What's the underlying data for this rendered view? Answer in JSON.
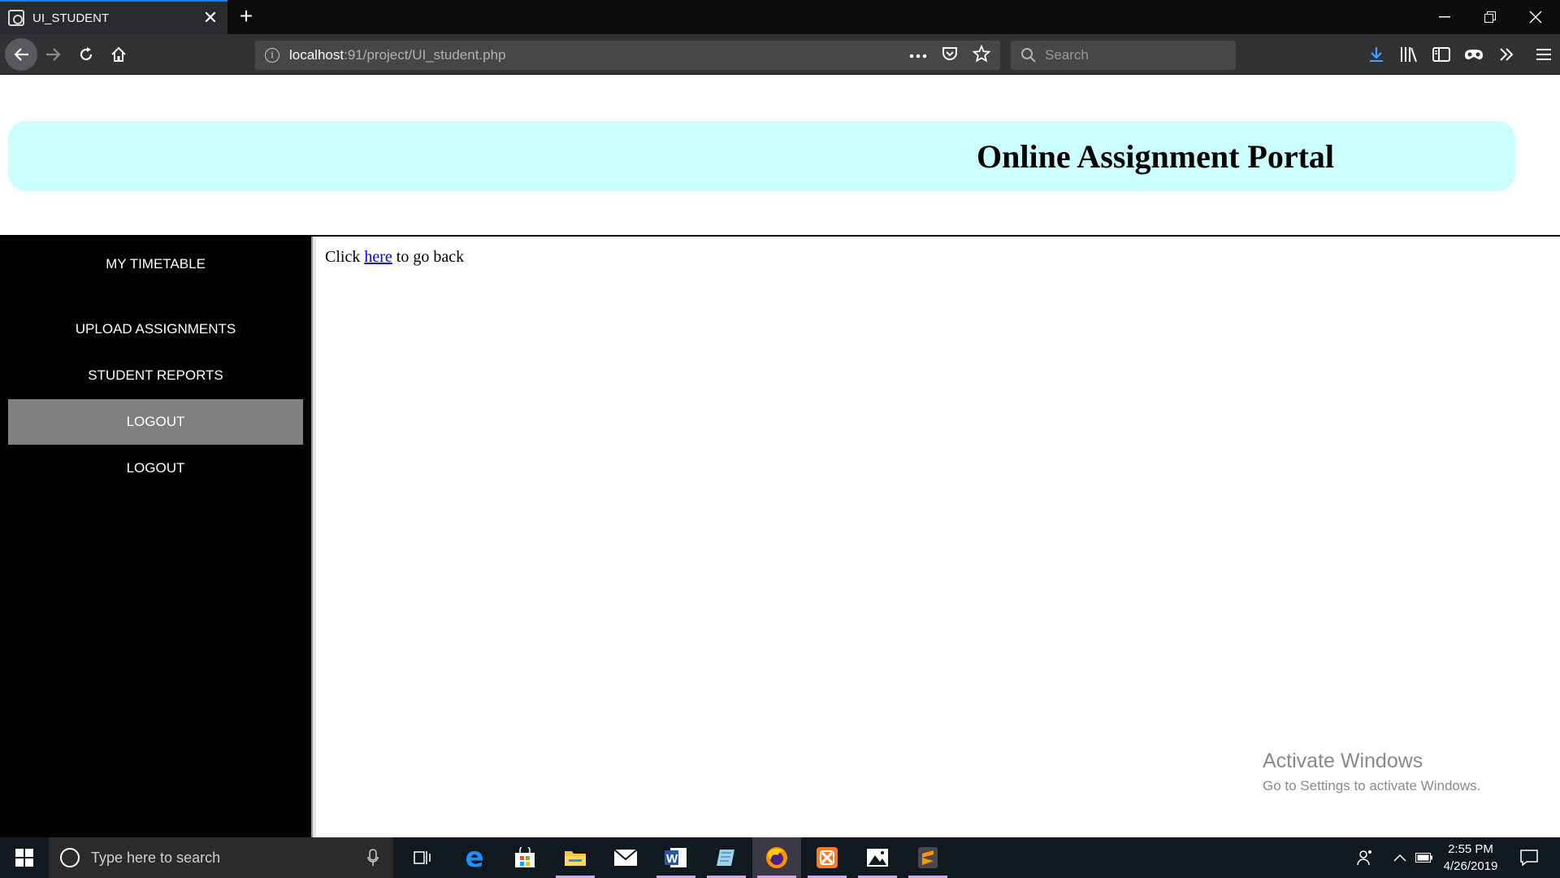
{
  "browser": {
    "tab_title": "UI_STUDENT",
    "url_host": "localhost",
    "url_rest": ":91/project/UI_student.php",
    "search_placeholder": "Search"
  },
  "page": {
    "banner_title": "Online Assignment Portal",
    "sidebar": {
      "items": [
        {
          "label": "MY TIMETABLE"
        },
        {
          "label": "UPLOAD ASSIGNMENTS"
        },
        {
          "label": "STUDENT REPORTS"
        },
        {
          "label": "LOGOUT"
        },
        {
          "label": "LOGOUT"
        }
      ],
      "active_index": 3
    },
    "content": {
      "prefix": "Click",
      "link": "here",
      "suffix": "to go back"
    },
    "watermark": {
      "line1": "Activate Windows",
      "line2": "Go to Settings to activate Windows."
    }
  },
  "taskbar": {
    "search_placeholder": "Type here to search",
    "time": "2:55 PM",
    "date": "4/26/2019"
  },
  "colors": {
    "banner_bg": "#ccffff",
    "sidebar_bg": "#000000",
    "sidebar_active": "#808080",
    "link": "#0000ee",
    "accent_tab": "#0a84ff"
  }
}
